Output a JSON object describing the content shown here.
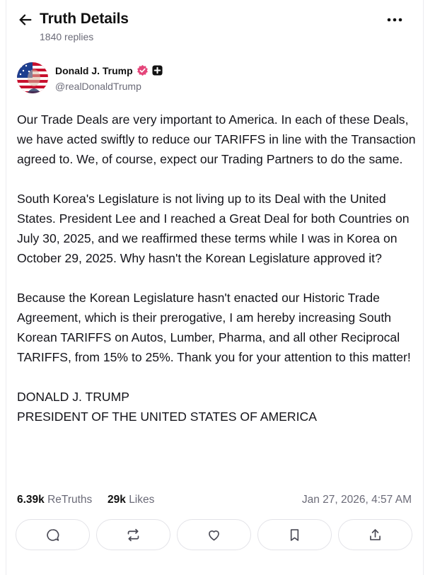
{
  "header": {
    "title": "Truth Details",
    "replies": "1840 replies"
  },
  "author": {
    "name": "Donald J. Trump",
    "handle": "@realDonaldTrump"
  },
  "post": {
    "paragraphs": [
      "Our Trade Deals are very important to America. In each of these Deals, we have acted swiftly to reduce our TARIFFS in line with the Transaction agreed to. We, of course, expect our Trading Partners to do the same.",
      "South Korea's Legislature is not living up to its Deal with the United States. President Lee and I reached a Great Deal for both Countries on July 30, 2025, and we reaffirmed these terms while I was in Korea on October 29, 2025. Why hasn't the Korean Legislature approved it?",
      "Because the Korean Legislature hasn't enacted our Historic Trade Agreement, which is their prerogative, I am hereby increasing South Korean TARIFFS on Autos, Lumber, Pharma, and all other Reciprocal TARIFFS, from 15% to 25%. Thank you for your attention to this matter!",
      "DONALD J. TRUMP\nPRESIDENT OF THE UNITED STATES OF AMERICA"
    ]
  },
  "stats": {
    "retruths_count": "6.39k",
    "retruths_label": "ReTruths",
    "likes_count": "29k",
    "likes_label": "Likes",
    "timestamp": "Jan 27, 2026, 4:57 AM"
  },
  "icons": {
    "back": "arrow-left-icon",
    "more": "more-horizontal-icon",
    "verified": "verified-badge-icon",
    "plus": "plus-badge-icon",
    "reply": "reply-icon",
    "retruth": "retruth-icon",
    "like": "heart-icon",
    "bookmark": "bookmark-icon",
    "share": "share-icon"
  },
  "colors": {
    "verified": "#e4457a",
    "muted": "#6b6b78",
    "border": "#e3e3e8"
  }
}
